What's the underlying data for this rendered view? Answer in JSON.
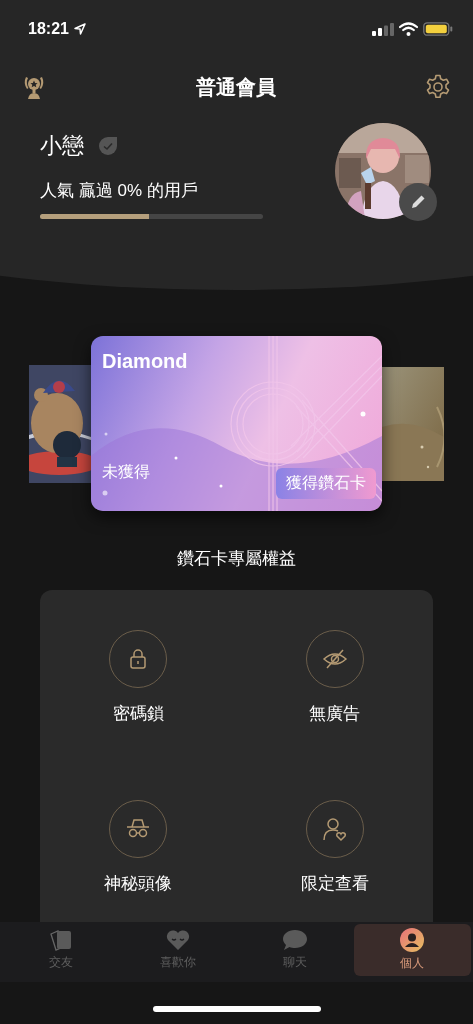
{
  "status_bar": {
    "time": "18:21"
  },
  "header": {
    "title": "普通會員"
  },
  "profile": {
    "name": "小戀",
    "popularity": "人氣 贏過 0% 的用戶",
    "level": 0.49
  },
  "cards": [
    {
      "kind": "picture"
    },
    {
      "kind": "card",
      "title": "Diamond",
      "status": "未獲得",
      "action": "獲得鑽石卡"
    },
    {
      "kind": "picture"
    }
  ],
  "benefits": {
    "title": "鑽石卡專屬權益",
    "items": [
      {
        "label": "密碼鎖"
      },
      {
        "label": "無廣告"
      },
      {
        "label": "神秘頭像"
      },
      {
        "label": "限定查看"
      }
    ]
  },
  "tabs": [
    {
      "label": "交友",
      "selected": false
    },
    {
      "label": "喜歡你",
      "selected": false
    },
    {
      "label": "聊天",
      "selected": false
    },
    {
      "label": "個人",
      "selected": true
    }
  ]
}
